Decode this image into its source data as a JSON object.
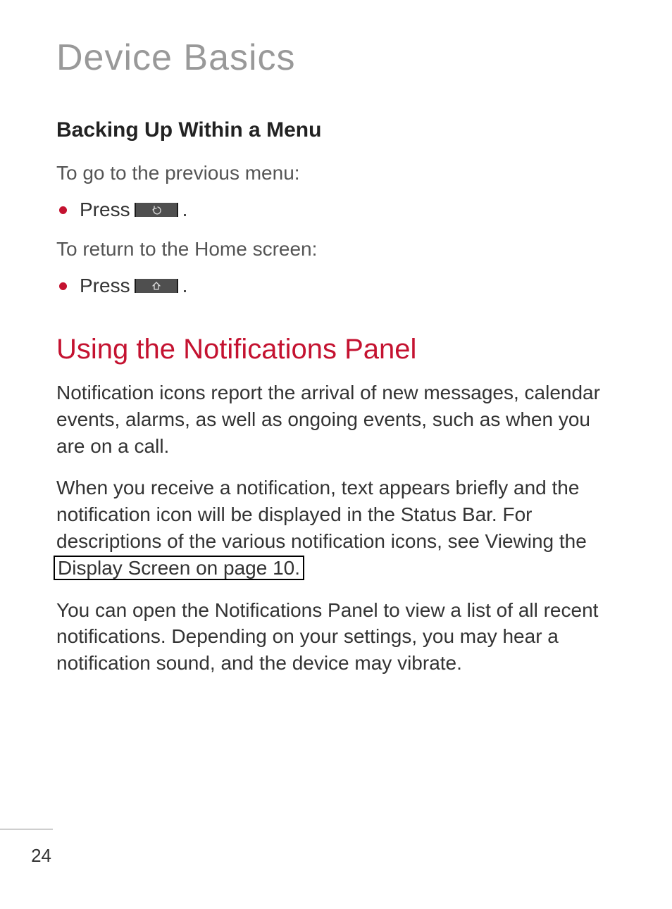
{
  "chapter": {
    "title": "Device Basics"
  },
  "sectionA": {
    "title": "Backing Up Within a Menu",
    "sub1": "To go to the previous menu:",
    "item1_prefix": "Press ",
    "item1_suffix": " .",
    "sub2": "To return to the Home screen:",
    "item2_prefix": "Press ",
    "item2_suffix": " ."
  },
  "sectionB": {
    "title": "Using the Notifications Panel",
    "p1": "Notification icons report the arrival of new messages, calendar events, alarms, as well as ongoing events, such as when you are on a call.",
    "p2a": "When you receive a notification, text appears briefly and the notification icon will be displayed in the Status Bar. For descriptions of the various notification icons, see Viewing the ",
    "p2b_link": "Display Screen on page 10.",
    "p3": "You can open the Notifications Panel to view a list of all recent notifications. Depending on your settings, you may hear a notification sound, and the device may vibrate."
  },
  "pageNumber": "24"
}
